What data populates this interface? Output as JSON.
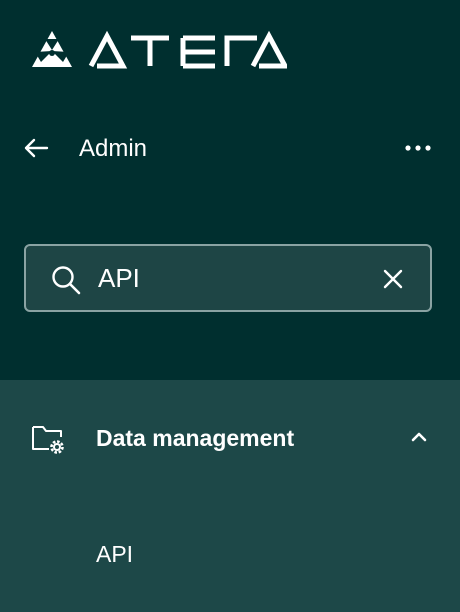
{
  "brand": {
    "logo_text": "ATERA",
    "colors": {
      "background": "#002f2f",
      "panel": "#1d4848",
      "search_bg": "#1e4545",
      "search_border": "#8aa3a3",
      "text": "#ffffff"
    }
  },
  "header": {
    "back_icon": "arrow-left-icon",
    "title": "Admin",
    "more_icon": "more-horizontal-icon"
  },
  "search": {
    "icon": "search-icon",
    "value": "API",
    "placeholder": "",
    "clear_icon": "close-icon"
  },
  "results": {
    "section": {
      "icon": "folder-settings-icon",
      "title": "Data management",
      "expanded": true,
      "chevron_icon": "chevron-up-icon",
      "items": [
        {
          "label": "API"
        }
      ]
    }
  }
}
